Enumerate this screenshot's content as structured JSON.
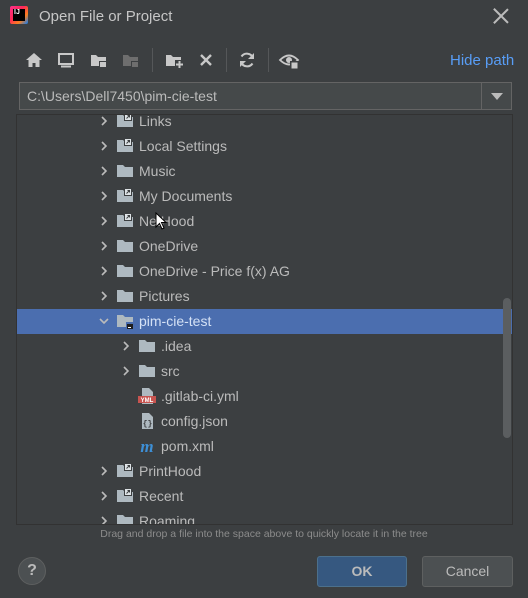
{
  "window": {
    "title": "Open File or Project",
    "app_icon_text": "IJ"
  },
  "toolbar": {
    "buttons": [
      {
        "name": "home-icon"
      },
      {
        "name": "desktop-icon"
      },
      {
        "name": "project-folder-icon"
      },
      {
        "name": "module-folder-icon"
      },
      {
        "name": "new-folder-icon"
      },
      {
        "name": "delete-icon"
      },
      {
        "name": "refresh-icon"
      },
      {
        "name": "show-hidden-icon"
      }
    ],
    "hide_path_label": "Hide path"
  },
  "path": {
    "value": "C:\\Users\\Dell7450\\pim-cie-test"
  },
  "tree": {
    "items": [
      {
        "label": "Links",
        "icon": "folder-link-icon"
      },
      {
        "label": "Local Settings",
        "icon": "folder-link-icon"
      },
      {
        "label": "Music",
        "icon": "folder-icon"
      },
      {
        "label": "My Documents",
        "icon": "folder-link-icon"
      },
      {
        "label": "NetHood",
        "icon": "folder-link-icon"
      },
      {
        "label": "OneDrive",
        "icon": "folder-icon"
      },
      {
        "label": "OneDrive - Price f(x) AG",
        "icon": "folder-icon"
      },
      {
        "label": "Pictures",
        "icon": "folder-icon"
      },
      {
        "label": "pim-cie-test",
        "icon": "project-folder-icon",
        "selected": true
      },
      {
        "label": ".idea",
        "icon": "folder-icon"
      },
      {
        "label": "src",
        "icon": "folder-icon"
      },
      {
        "label": ".gitlab-ci.yml",
        "icon": "yml-file-icon"
      },
      {
        "label": "config.json",
        "icon": "json-file-icon"
      },
      {
        "label": "pom.xml",
        "icon": "maven-file-icon"
      },
      {
        "label": "PrintHood",
        "icon": "folder-link-icon"
      },
      {
        "label": "Recent",
        "icon": "folder-link-icon"
      },
      {
        "label": "Roaming",
        "icon": "folder-icon"
      }
    ]
  },
  "hint_text": "Drag and drop a file into the space above to quickly locate it in the tree",
  "footer": {
    "help_label": "?",
    "ok_label": "OK",
    "cancel_label": "Cancel"
  },
  "colors": {
    "background": "#3c3f41",
    "selection": "#4b6eaf",
    "link": "#589df6",
    "ok_button": "#365880"
  }
}
